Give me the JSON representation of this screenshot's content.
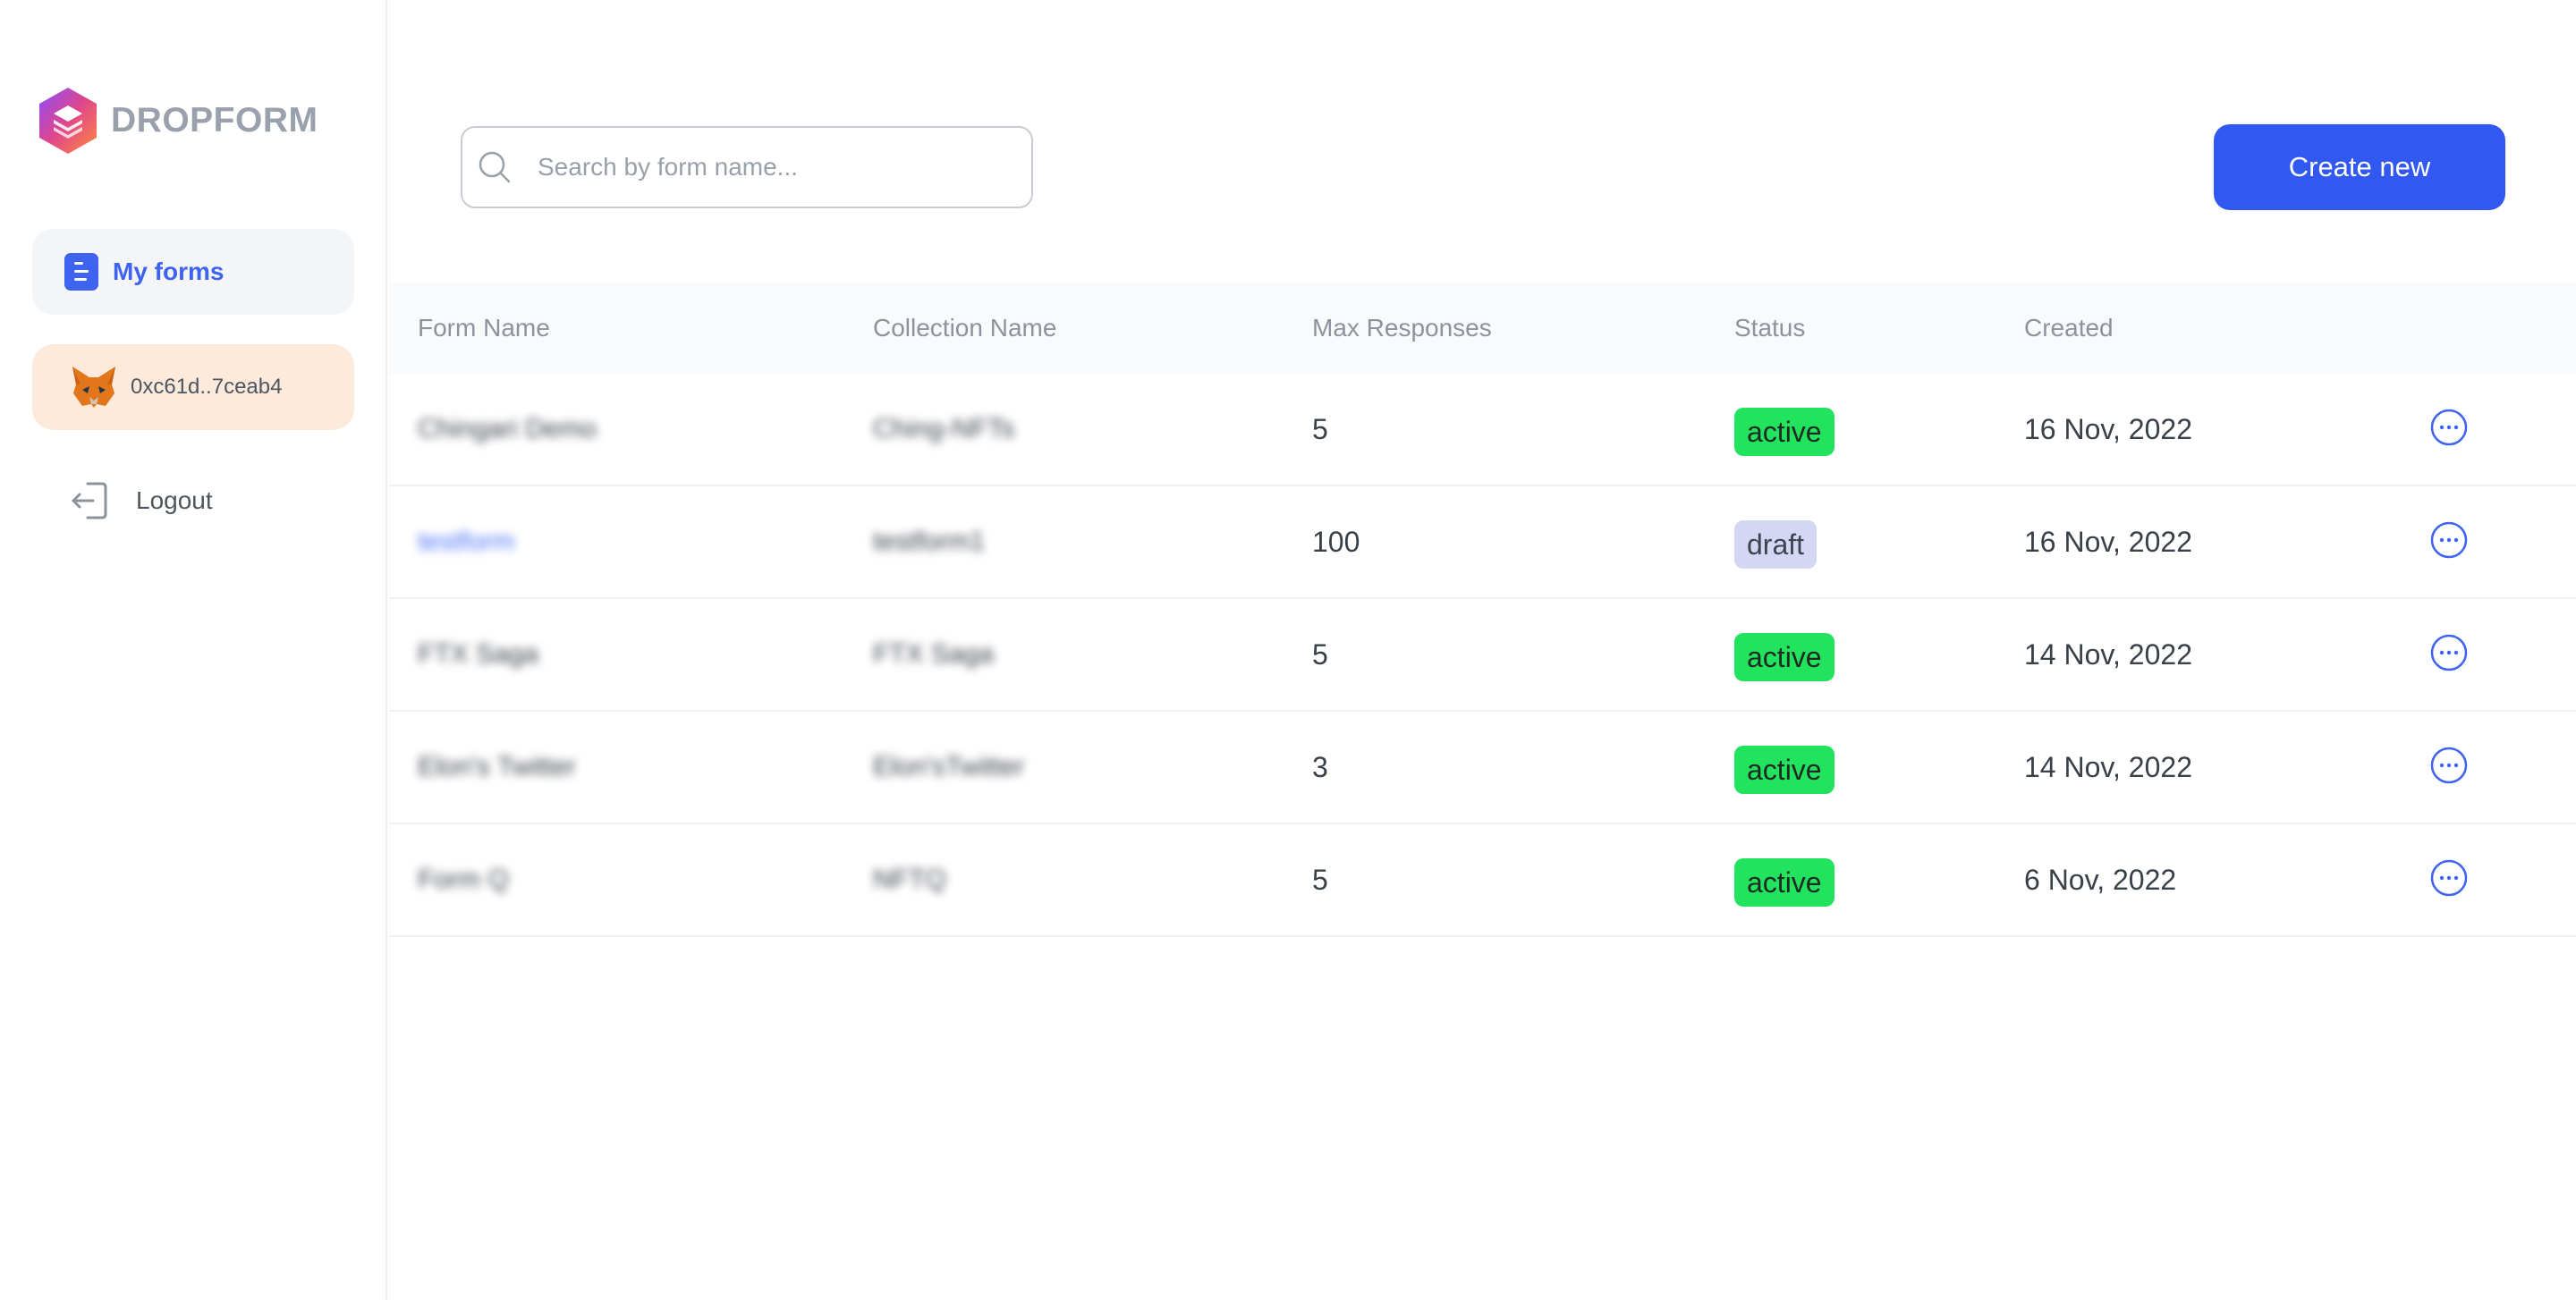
{
  "brand": {
    "name": "DROPFORM"
  },
  "sidebar": {
    "items": [
      {
        "label": "My forms",
        "icon": "document-icon"
      },
      {
        "label": "0xc61d..7ceab4",
        "icon": "metamask-fox-icon"
      },
      {
        "label": "Logout",
        "icon": "logout-icon"
      }
    ]
  },
  "search": {
    "placeholder": "Search by form name...",
    "value": ""
  },
  "toolbar": {
    "create_label": "Create new"
  },
  "table": {
    "headers": [
      "Form Name",
      "Collection Name",
      "Max Responses",
      "Status",
      "Created"
    ],
    "rows": [
      {
        "form_name": "Chingari Demo",
        "collection": "Ching-NFTs",
        "max": "5",
        "status": "active",
        "created": "16 Nov, 2022"
      },
      {
        "form_name": "testform",
        "collection": "testform1",
        "max": "100",
        "status": "draft",
        "created": "16 Nov, 2022"
      },
      {
        "form_name": "FTX Saga",
        "collection": "FTX Saga",
        "max": "5",
        "status": "active",
        "created": "14 Nov, 2022"
      },
      {
        "form_name": "Elon's Twitter",
        "collection": "Elon'sTwitter",
        "max": "3",
        "status": "active",
        "created": "14 Nov, 2022"
      },
      {
        "form_name": "Form Q",
        "collection": "NFTQ",
        "max": "5",
        "status": "active",
        "created": "6 Nov, 2022"
      }
    ]
  },
  "colors": {
    "accent": "#3258f2",
    "active": "#22e35d",
    "draft": "#d3d7f4",
    "wallet_bg": "#fdeadb"
  }
}
